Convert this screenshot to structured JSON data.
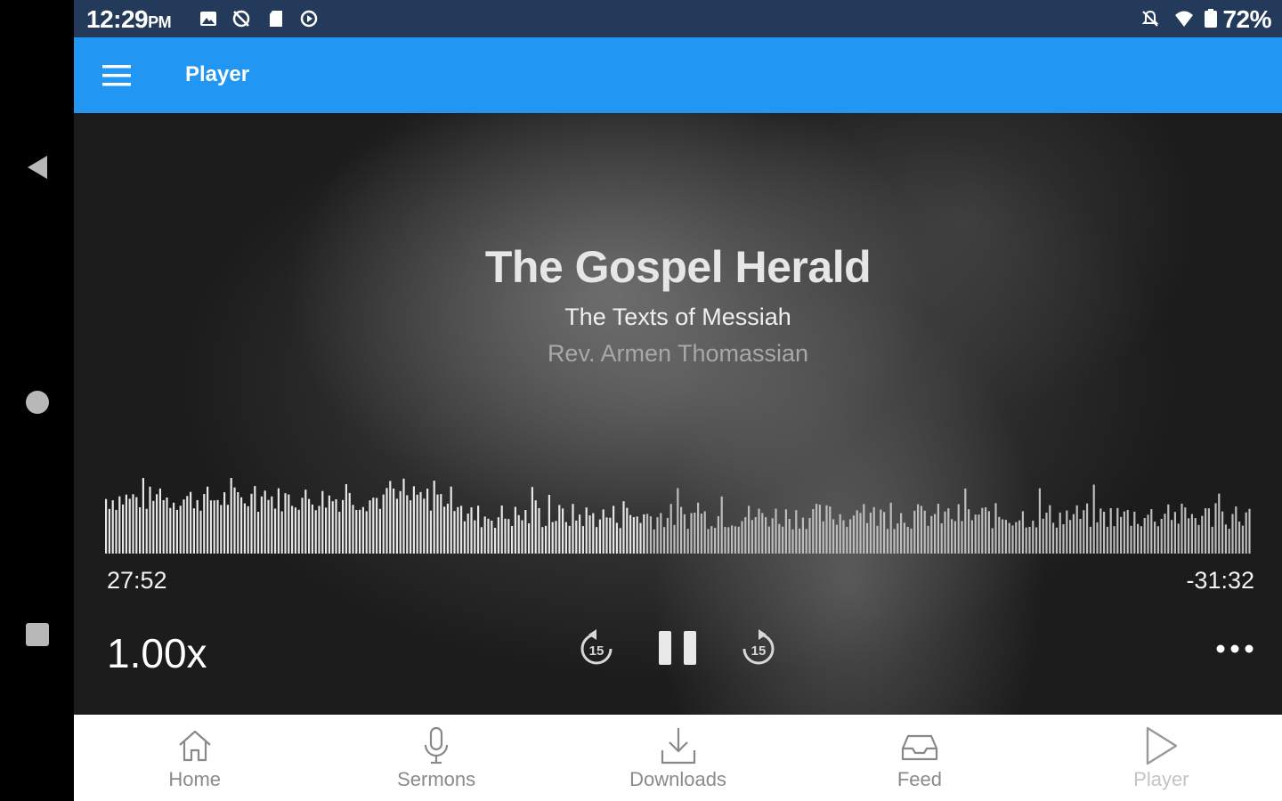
{
  "status_bar": {
    "time": "12:29",
    "ampm": "PM",
    "battery": "72%",
    "left_icons": [
      "image-icon",
      "sync-off-icon",
      "sd-card-icon",
      "play-circle-icon"
    ],
    "right_icons": [
      "bell-off-icon",
      "wifi-icon",
      "battery-icon"
    ]
  },
  "app_bar": {
    "title": "Player",
    "menu_icon": "hamburger-menu-icon",
    "color": "#2196f3"
  },
  "player": {
    "title": "The Gospel Herald",
    "subtitle": "The Texts of Messiah",
    "speaker": "Rev. Armen Thomassian",
    "elapsed": "27:52",
    "remaining": "-31:32",
    "speed": "1.00x",
    "state": "playing",
    "progress": 0.47,
    "controls": {
      "rewind": "rewind-15-icon",
      "pause": "pause-icon",
      "forward": "forward-15-icon",
      "more": "more-horizontal-icon"
    }
  },
  "tabs": [
    {
      "label": "Home",
      "icon": "home-icon",
      "enabled": true
    },
    {
      "label": "Sermons",
      "icon": "microphone-icon",
      "enabled": true
    },
    {
      "label": "Downloads",
      "icon": "download-icon",
      "enabled": true
    },
    {
      "label": "Feed",
      "icon": "inbox-icon",
      "enabled": true
    },
    {
      "label": "Player",
      "icon": "play-icon",
      "enabled": false
    }
  ],
  "system_nav": {
    "buttons": [
      "back-icon",
      "home-circle-icon",
      "recents-icon"
    ]
  }
}
